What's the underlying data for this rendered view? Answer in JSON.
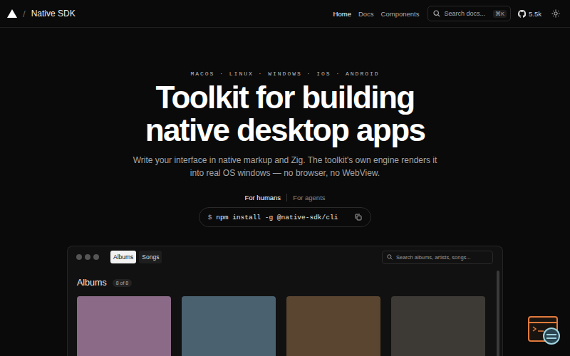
{
  "nav": {
    "separator": "/",
    "brand": "Native SDK",
    "links": [
      {
        "label": "Home",
        "selected": true
      },
      {
        "label": "Docs",
        "selected": false
      },
      {
        "label": "Components",
        "selected": false
      }
    ],
    "search": {
      "placeholder": "Search docs...",
      "shortcut": "⌘K"
    },
    "github_stars": "5.5k"
  },
  "hero": {
    "platforms": "MACOS · LINUX · WINDOWS · IOS · ANDROID",
    "title": [
      "Toolkit for building",
      "native desktop apps"
    ],
    "subtitle": [
      "Write your interface in native markup and Zig. The toolkit's own engine renders it",
      "into real OS windows — no browser, no WebView."
    ],
    "install_tabs": [
      {
        "label": "For humans",
        "selected": true
      },
      {
        "label": "For agents",
        "selected": false
      }
    ],
    "command": {
      "prompt": "$",
      "text": "npm install -g @native-sdk/cli"
    }
  },
  "demo": {
    "tabs": [
      {
        "label": "Albums",
        "selected": true
      },
      {
        "label": "Songs",
        "selected": false
      }
    ],
    "search": {
      "placeholder": "Search albums, artists, songs..."
    },
    "heading": "Albums",
    "count": "8 of 8",
    "albums": [
      {
        "color": "#8a6a86"
      },
      {
        "color": "#4a6170"
      },
      {
        "color": "#5a4530"
      },
      {
        "color": "#3d3a36"
      }
    ]
  }
}
